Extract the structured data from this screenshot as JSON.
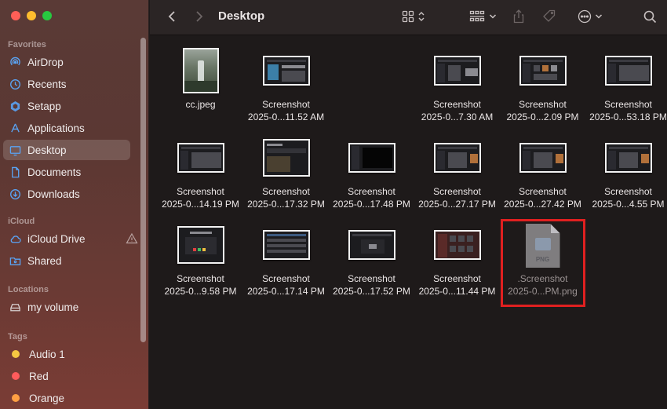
{
  "window": {
    "title": "Desktop"
  },
  "sidebar": {
    "sections": [
      {
        "heading": "Favorites",
        "items": [
          {
            "label": "AirDrop",
            "icon": "airdrop-icon"
          },
          {
            "label": "Recents",
            "icon": "clock-icon"
          },
          {
            "label": "Setapp",
            "icon": "setapp-icon"
          },
          {
            "label": "Applications",
            "icon": "applications-icon"
          },
          {
            "label": "Desktop",
            "icon": "desktop-icon",
            "active": true
          },
          {
            "label": "Documents",
            "icon": "document-icon"
          },
          {
            "label": "Downloads",
            "icon": "download-icon"
          }
        ]
      },
      {
        "heading": "iCloud",
        "items": [
          {
            "label": "iCloud Drive",
            "icon": "cloud-icon"
          },
          {
            "label": "Shared",
            "icon": "shared-folder-icon"
          }
        ]
      },
      {
        "heading": "Locations",
        "items": [
          {
            "label": "my volume",
            "icon": "drive-icon"
          }
        ]
      },
      {
        "heading": "Tags",
        "items": [
          {
            "label": "Audio 1",
            "color": "#f5c842"
          },
          {
            "label": "Red",
            "color": "#ff5b5b"
          },
          {
            "label": "Orange",
            "color": "#ff9f43"
          }
        ]
      }
    ]
  },
  "files": [
    {
      "name": "cc.jpeg",
      "sub": ""
    },
    {
      "name": "Screenshot",
      "sub": "2025-0...11.52 AM"
    },
    {
      "name": "",
      "sub": ""
    },
    {
      "name": "Screenshot",
      "sub": "2025-0...7.30 AM"
    },
    {
      "name": "Screenshot",
      "sub": "2025-0...2.09 PM"
    },
    {
      "name": "Screenshot",
      "sub": "2025-0...53.18 PM"
    },
    {
      "name": "Screenshot",
      "sub": "2025-0...14.19 PM"
    },
    {
      "name": "Screenshot",
      "sub": "2025-0...17.32 PM"
    },
    {
      "name": "Screenshot",
      "sub": "2025-0...17.48 PM"
    },
    {
      "name": "Screenshot",
      "sub": "2025-0...27.17 PM"
    },
    {
      "name": "Screenshot",
      "sub": "2025-0...27.42 PM"
    },
    {
      "name": "Screenshot",
      "sub": "2025-0...4.55 PM"
    },
    {
      "name": "Screenshot",
      "sub": "2025-0...9.58 PM"
    },
    {
      "name": "Screenshot",
      "sub": "2025-0...17.14 PM"
    },
    {
      "name": "Screenshot",
      "sub": "2025-0...17.52 PM"
    },
    {
      "name": "Screenshot",
      "sub": "2025-0...11.44 PM"
    },
    {
      "name": ".Screenshot",
      "sub": "2025-0...PM.png",
      "icon_label": "PNG"
    }
  ],
  "colors": {
    "sidebar": "#5b3833",
    "content": "#1e1a1a",
    "toolbar": "#2b2525",
    "accent": "#5aa4f5",
    "highlight": "#e02020"
  }
}
